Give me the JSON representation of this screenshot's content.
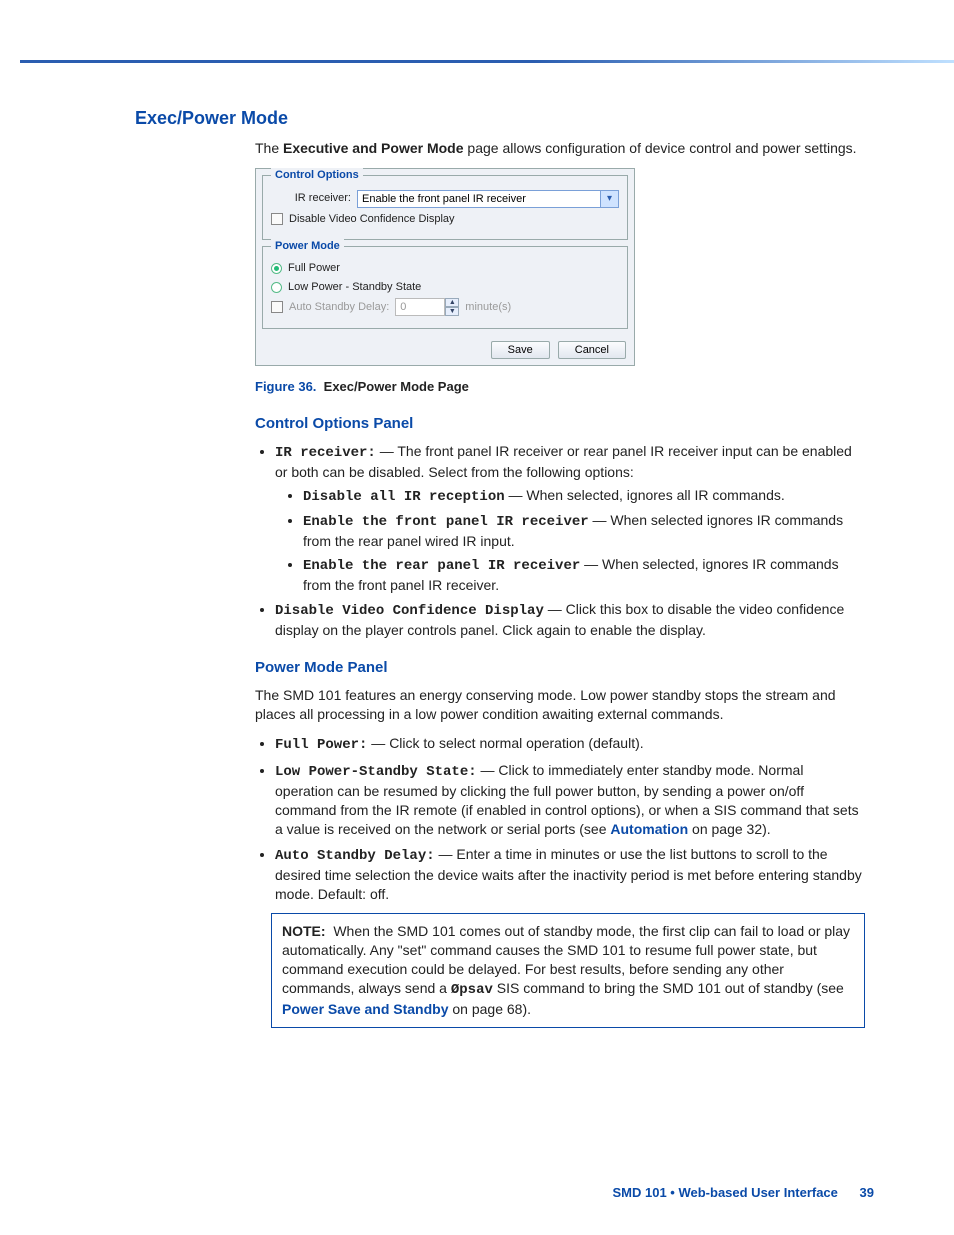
{
  "heading": "Exec/Power Mode",
  "intro_pre": "The ",
  "intro_bold": "Executive and Power Mode",
  "intro_post": " page allows configuration of device control and power settings.",
  "figure": {
    "label": "Figure 36.",
    "caption": "Exec/Power Mode Page"
  },
  "shot": {
    "group1_legend": "Control Options",
    "ir_label": "IR receiver:",
    "ir_value": "Enable the front panel IR receiver",
    "disable_vcd": "Disable Video Confidence Display",
    "group2_legend": "Power Mode",
    "full_power": "Full Power",
    "low_power": "Low Power - Standby State",
    "auto_delay_label": "Auto Standby Delay:",
    "auto_delay_value": "0",
    "minutes": "minute(s)",
    "save": "Save",
    "cancel": "Cancel"
  },
  "cop": {
    "title": "Control Options Panel",
    "ir_term": "IR receiver:",
    "ir_text": " — The front panel IR receiver or rear panel IR receiver input can be enabled or both can be disabled. Select from the following options:",
    "opt1_term": "Disable all IR reception",
    "opt1_text": " — When selected, ignores all IR commands.",
    "opt2_term": "Enable the front panel IR receiver",
    "opt2_text": " — When selected ignores IR commands from the rear panel wired IR input.",
    "opt3_term": "Enable the rear panel IR receiver",
    "opt3_text": " — When selected, ignores IR commands from the front panel IR receiver.",
    "dvcd_term": "Disable Video Confidence Display",
    "dvcd_text": " — Click this box to disable the video confidence display on the player controls panel. Click again to enable the display."
  },
  "pmp": {
    "title": "Power Mode Panel",
    "intro": "The SMD 101 features an energy conserving mode. Low power standby stops the stream and places all processing in a low power condition awaiting external commands.",
    "fp_term": "Full Power:",
    "fp_text": " — Click to select normal operation (default).",
    "lp_term": "Low Power-Standby State:",
    "lp_text_a": " — Click to immediately enter standby mode. Normal operation can be resumed by clicking the full power button, by sending a power on/off command from the IR remote (if enabled in control options), or when a SIS command that sets a value is received on the network or serial ports (see ",
    "lp_link": "Automation",
    "lp_text_b": " on page 32).",
    "asd_term": "Auto Standby Delay:",
    "asd_text": " — Enter a time in minutes or use the list buttons to scroll to the desired time selection the device waits after the inactivity period is met before entering standby mode. Default: off."
  },
  "note": {
    "label": "NOTE:",
    "a": "When the SMD 101 comes out of standby mode, the first clip can fail to load or play automatically. Any \"set\" command causes the SMD 101 to resume full power state, but command execution could be delayed. For best results, before sending any other commands, always send a ",
    "cmd": "Øpsav",
    "b": " SIS command to bring the SMD 101 out of standby (see ",
    "link": "Power Save and Standby",
    "c": " on page 68)."
  },
  "footer": {
    "title": "SMD 101 • Web-based User Interface",
    "page": "39"
  }
}
